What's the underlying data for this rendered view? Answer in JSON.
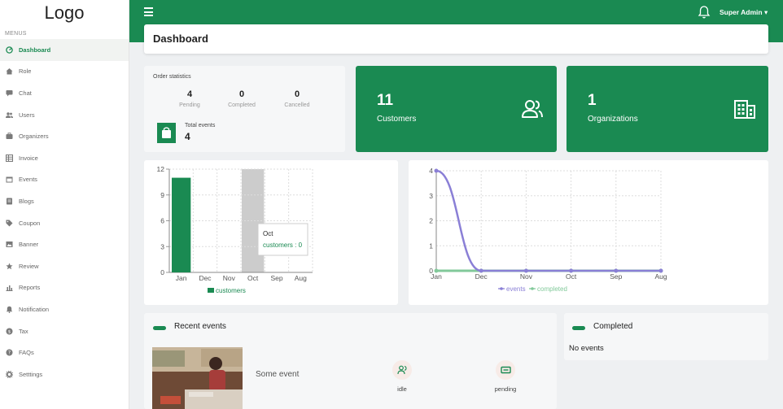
{
  "brand": {
    "logo_text": "Logo"
  },
  "sidebar": {
    "menus_label": "MENUS",
    "items": [
      {
        "label": "Dashboard",
        "icon": "dashboard-icon",
        "active": true
      },
      {
        "label": "Role",
        "icon": "home-icon"
      },
      {
        "label": "Chat",
        "icon": "chat-icon"
      },
      {
        "label": "Users",
        "icon": "users-icon"
      },
      {
        "label": "Organizers",
        "icon": "organizers-icon"
      },
      {
        "label": "Invoice",
        "icon": "invoice-icon"
      },
      {
        "label": "Events",
        "icon": "events-icon"
      },
      {
        "label": "Blogs",
        "icon": "blogs-icon"
      },
      {
        "label": "Coupon",
        "icon": "tag-icon"
      },
      {
        "label": "Banner",
        "icon": "banner-icon"
      },
      {
        "label": "Review",
        "icon": "star-icon"
      },
      {
        "label": "Reports",
        "icon": "reports-icon"
      },
      {
        "label": "Notification",
        "icon": "bell-icon"
      },
      {
        "label": "Tax",
        "icon": "tax-icon"
      },
      {
        "label": "FAQs",
        "icon": "question-icon"
      },
      {
        "label": "Setttings",
        "icon": "gear-icon"
      }
    ]
  },
  "topbar": {
    "user_label": "Super Admin ▾",
    "accent_color": "#1a8a52"
  },
  "page": {
    "title": "Dashboard"
  },
  "order_stats": {
    "title": "Order statistics",
    "stats": [
      {
        "value": "4",
        "label": "Pending"
      },
      {
        "value": "0",
        "label": "Completed"
      },
      {
        "value": "0",
        "label": "Cancelled"
      }
    ],
    "total_label": "Total events",
    "total_value": "4"
  },
  "customers_card": {
    "value": "11",
    "label": "Customers",
    "icon": "users-icon"
  },
  "organizations_card": {
    "value": "1",
    "label": "Organizations",
    "icon": "building-icon"
  },
  "chart_data": [
    {
      "type": "bar",
      "categories": [
        "Jan",
        "Dec",
        "Nov",
        "Oct",
        "Sep",
        "Aug"
      ],
      "series": [
        {
          "name": "customers",
          "values": [
            11,
            0,
            0,
            0,
            0,
            0
          ],
          "color": "#1a8a52"
        }
      ],
      "yticks": [
        0,
        3,
        6,
        9,
        12
      ],
      "ylim": [
        0,
        12
      ],
      "grid": true,
      "legend": "bottom",
      "highlight_category": "Oct",
      "tooltip": {
        "title": "Oct",
        "text": "customers : 0"
      }
    },
    {
      "type": "line",
      "categories": [
        "Jan",
        "Dec",
        "Nov",
        "Oct",
        "Sep",
        "Aug"
      ],
      "series": [
        {
          "name": "events",
          "values": [
            4,
            0,
            0,
            0,
            0,
            0
          ],
          "color": "#8a7fd6"
        },
        {
          "name": "completed",
          "values": [
            0,
            0,
            0,
            0,
            0,
            0
          ],
          "color": "#82c99a"
        }
      ],
      "yticks": [
        0,
        1,
        2,
        3,
        4
      ],
      "ylim": [
        0,
        4
      ],
      "grid": true,
      "legend": "bottom"
    }
  ],
  "recent_events": {
    "title": "Recent events",
    "event": {
      "name": "Some event",
      "status1": "idle",
      "status2": "pending"
    }
  },
  "completed": {
    "title": "Completed",
    "empty_text": "No events"
  }
}
